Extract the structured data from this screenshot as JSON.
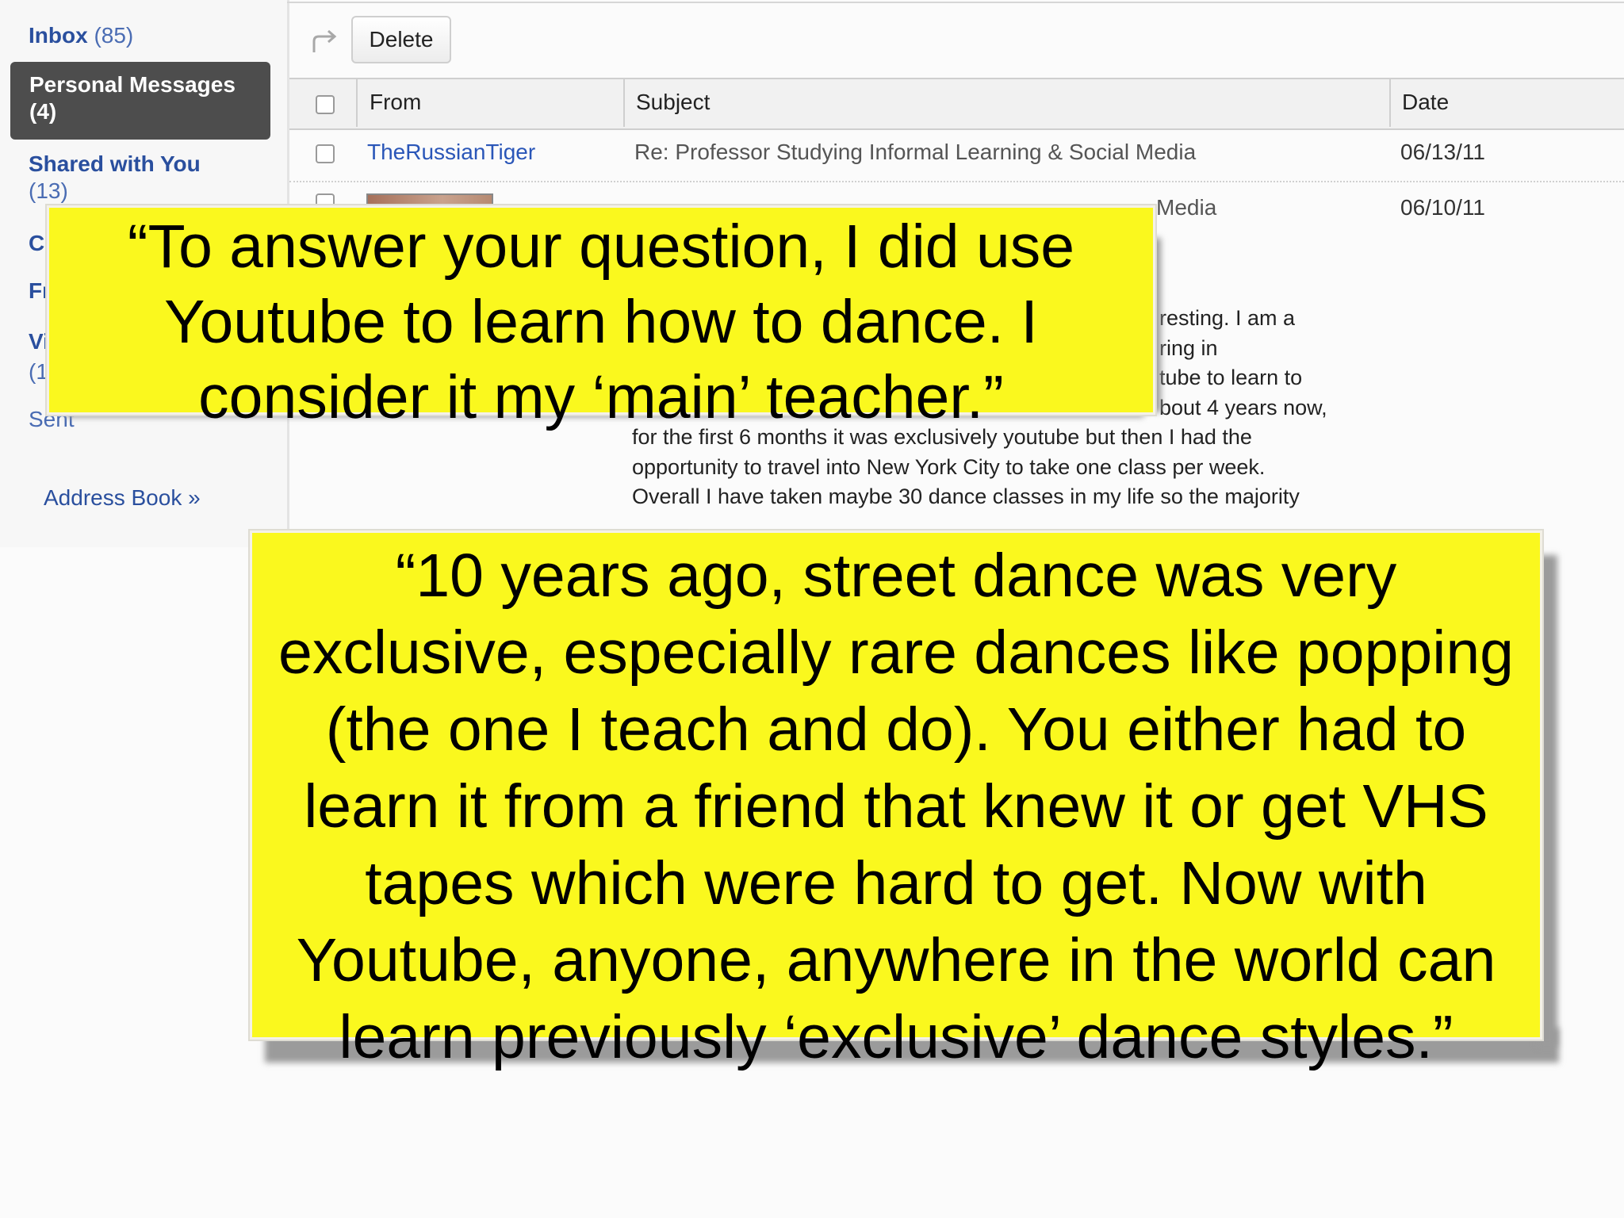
{
  "sidebar": {
    "inbox_label": "Inbox",
    "inbox_count": "(85)",
    "personal_label": "Personal Messages",
    "personal_count": "(4)",
    "shared_label": "Shared with You",
    "shared_count": "(13)",
    "partial_items": [
      "Co",
      "Fr",
      "Vi",
      "(1",
      "Sent"
    ],
    "address_book": "Address Book »"
  },
  "toolbar": {
    "reply_icon": "reply-arrow-icon",
    "delete_label": "Delete"
  },
  "table": {
    "headers": {
      "from": "From",
      "subject": "Subject",
      "date": "Date"
    },
    "rows": [
      {
        "from": "TheRussianTiger",
        "subject": "Re: Professor Studying Informal Learning & Social Media",
        "date": "06/13/11"
      },
      {
        "from": "",
        "subject": "Media",
        "date": "06/10/11"
      }
    ]
  },
  "message_preview": {
    "lines": [
      "resting. I am a",
      "ring in",
      "tube to learn to",
      "bout 4 years now,",
      "for the first 6 months it was exclusively youtube but then I had the",
      "opportunity to travel into New York City to take one class per week.",
      "Overall I have taken maybe 30 dance classes in my life so the majority"
    ]
  },
  "callouts": {
    "quote1": [
      "“To answer your question, I did use",
      "Youtube to learn how to dance. I",
      "consider it my ‘main’ teacher.”"
    ],
    "quote2": [
      "“10 years ago, street dance was very",
      "exclusive, especially rare dances like popping",
      "(the one I teach and do). You either had to",
      "learn it from a friend that knew it or get VHS",
      "tapes which were hard to get. Now with",
      "Youtube, anyone, anywhere in the world can",
      "learn previously ‘exclusive’ dance styles.”"
    ],
    "highlight_color": "#faf81e"
  }
}
